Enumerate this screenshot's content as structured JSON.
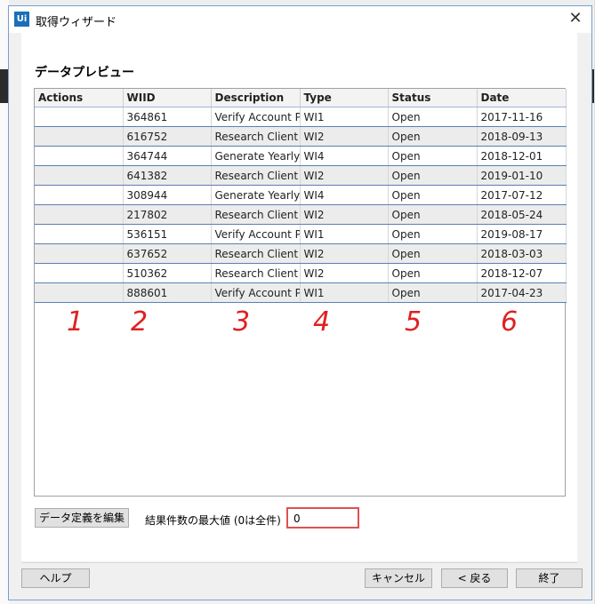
{
  "dialog": {
    "app_icon_text": "Ui",
    "title": "取得ウィザード",
    "close_glyph": "✕"
  },
  "section": {
    "title": "データプレビュー"
  },
  "table": {
    "columns": [
      "Actions",
      "WIID",
      "Description",
      "Type",
      "Status",
      "Date"
    ],
    "rows": [
      {
        "actions": "",
        "wiid": "364861",
        "description": "Verify Account Pc",
        "type": "WI1",
        "status": "Open",
        "date": "2017-11-16"
      },
      {
        "actions": "",
        "wiid": "616752",
        "description": "Research Client C",
        "type": "WI2",
        "status": "Open",
        "date": "2018-09-13"
      },
      {
        "actions": "",
        "wiid": "364744",
        "description": "Generate Yearly F",
        "type": "WI4",
        "status": "Open",
        "date": "2018-12-01"
      },
      {
        "actions": "",
        "wiid": "641382",
        "description": "Research Client C",
        "type": "WI2",
        "status": "Open",
        "date": "2019-01-10"
      },
      {
        "actions": "",
        "wiid": "308944",
        "description": "Generate Yearly F",
        "type": "WI4",
        "status": "Open",
        "date": "2017-07-12"
      },
      {
        "actions": "",
        "wiid": "217802",
        "description": "Research Client C",
        "type": "WI2",
        "status": "Open",
        "date": "2018-05-24"
      },
      {
        "actions": "",
        "wiid": "536151",
        "description": "Verify Account Pc",
        "type": "WI1",
        "status": "Open",
        "date": "2019-08-17"
      },
      {
        "actions": "",
        "wiid": "637652",
        "description": "Research Client C",
        "type": "WI2",
        "status": "Open",
        "date": "2018-03-03"
      },
      {
        "actions": "",
        "wiid": "510362",
        "description": "Research Client C",
        "type": "WI2",
        "status": "Open",
        "date": "2018-12-07"
      },
      {
        "actions": "",
        "wiid": "888601",
        "description": "Verify Account Pc",
        "type": "WI1",
        "status": "Open",
        "date": "2017-04-23"
      }
    ]
  },
  "annotations": [
    "1",
    "2",
    "3",
    "4",
    "5",
    "6"
  ],
  "controls": {
    "edit_data_definition": "データ定義を編集",
    "max_results_label": "結果件数の最大値 (0は全件)",
    "max_results_value": "0"
  },
  "footer": {
    "help": "ヘルプ",
    "cancel": "キャンセル",
    "back": "< 戻る",
    "finish": "終了"
  },
  "colors": {
    "accent": "#1a6fb8",
    "annotation_red": "#e02020",
    "row_border_blue": "#5b7fb3"
  }
}
